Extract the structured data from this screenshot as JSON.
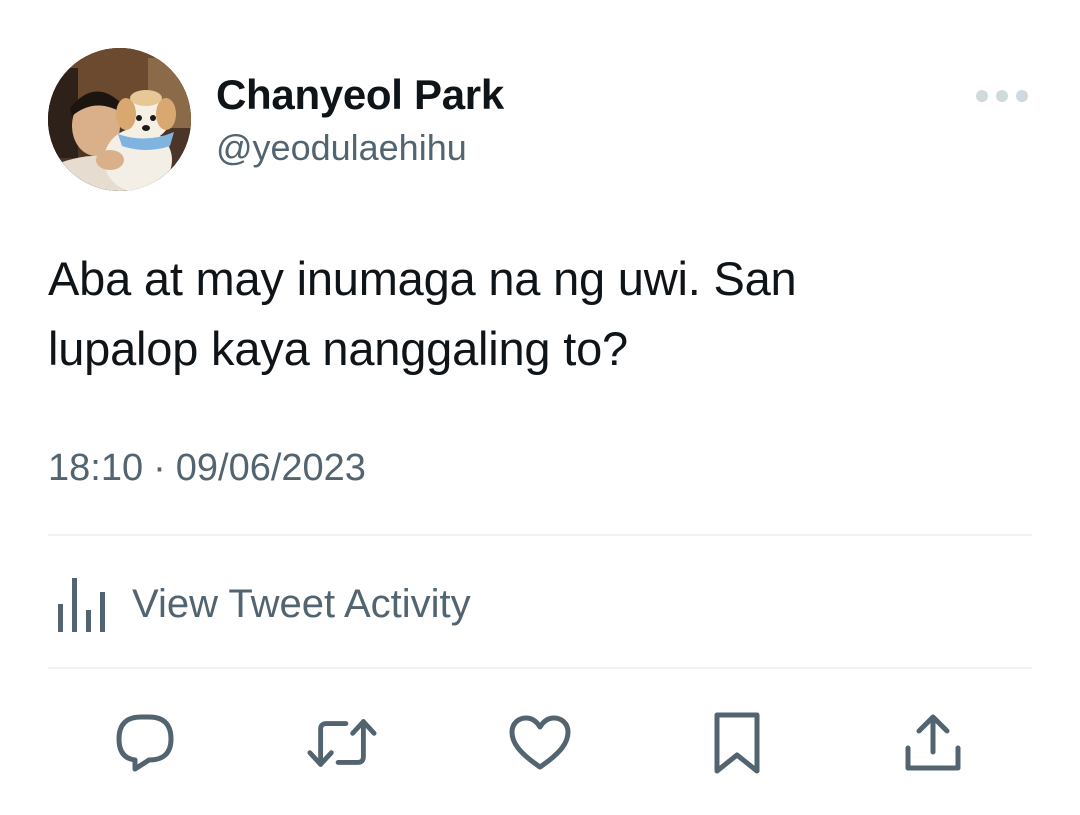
{
  "user": {
    "display_name": "Chanyeol Park",
    "handle": "@yeodulaehihu"
  },
  "tweet": {
    "text": "Aba at may inumaga na ng uwi. San\nlupalop kaya nanggaling to?",
    "time": "18:10",
    "separator": "·",
    "date": "09/06/2023"
  },
  "activity": {
    "label": "View Tweet Activity",
    "icon": "bar-chart-icon"
  },
  "actions": [
    {
      "name": "reply",
      "icon": "comment-bubble-icon"
    },
    {
      "name": "retweet",
      "icon": "retweet-arrows-icon"
    },
    {
      "name": "like",
      "icon": "heart-icon"
    },
    {
      "name": "bookmark",
      "icon": "bookmark-icon"
    },
    {
      "name": "share",
      "icon": "share-upload-icon"
    }
  ],
  "colors": {
    "text_primary": "#0f1419",
    "text_secondary": "#536471",
    "divider": "#eff3f4",
    "icon": "#536471",
    "more_dots": "#cfd9de"
  }
}
